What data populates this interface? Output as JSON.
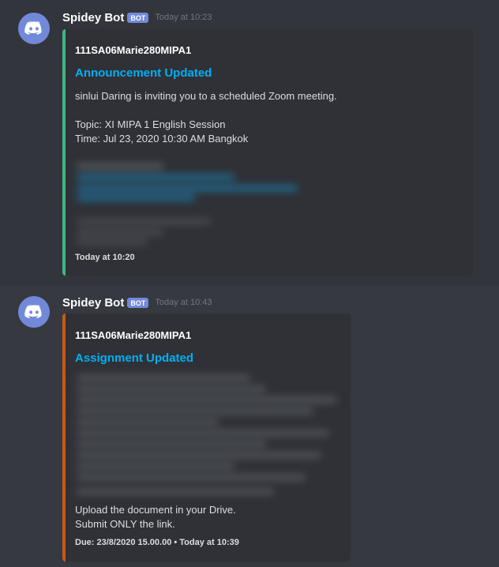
{
  "messages": [
    {
      "username": "Spidey Bot",
      "bot_tag": "BOT",
      "timestamp": "Today at 10:23",
      "avatar_icon": "discord-logo-icon",
      "embed": {
        "accent": "#43b581",
        "author": "111SA06Marie280MIPA1",
        "title": "Announcement Updated",
        "description": "sinlui Daring is inviting you to a scheduled Zoom meeting.\n\nTopic: XI MIPA 1 English Session\nTime: Jul 23, 2020 10:30 AM Bangkok",
        "footer": "Today at 10:20"
      }
    },
    {
      "username": "Spidey Bot",
      "bot_tag": "BOT",
      "timestamp": "Today at 10:43",
      "avatar_icon": "discord-logo-icon",
      "embed": {
        "accent": "#c65a16",
        "author": "111SA06Marie280MIPA1",
        "title": "Assignment Updated",
        "description": "Upload the document in your Drive.\nSubmit ONLY the link.",
        "footer": "Due: 23/8/2020 15.00.00 • Today at 10:39"
      }
    }
  ],
  "colors": {
    "background": "#36393f",
    "embed_bg": "#2f3136",
    "link": "#00b0f4",
    "blurple": "#7289da"
  }
}
